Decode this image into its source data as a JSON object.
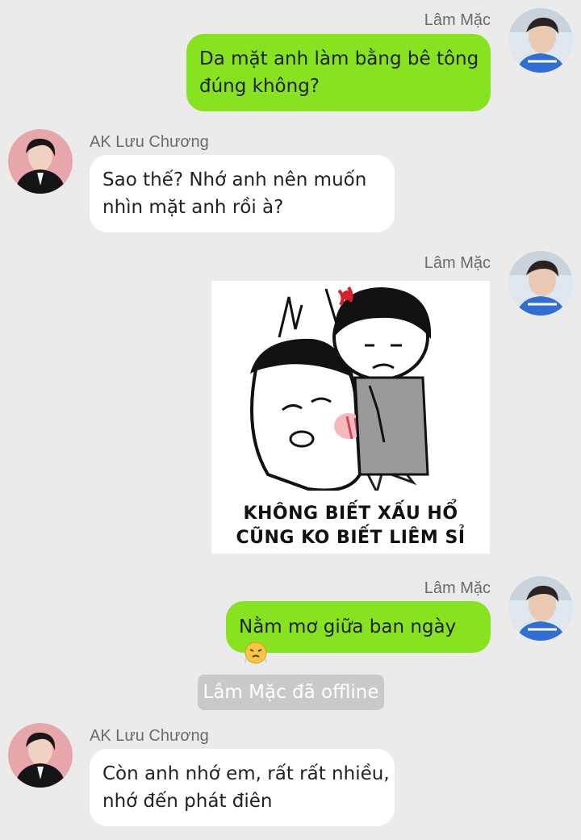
{
  "messages": [
    {
      "sender": "Lâm Mặc",
      "text_lines": [
        "Da mặt anh làm bằng bê tông",
        "đúng không?"
      ]
    },
    {
      "sender": "AK Lưu Chương",
      "text_lines": [
        "Sao thế? Nhớ anh nên muốn",
        "nhìn mặt anh rồi à?"
      ]
    },
    {
      "sender": "Lâm Mặc",
      "sticker_caption_lines": [
        "KHÔNG BIẾT XẤU HỔ",
        "CŨNG KO BIẾT LIÊM SỈ"
      ]
    },
    {
      "sender": "Lâm Mặc",
      "text": "Nằm mơ giữa ban ngày",
      "emoji": "huffing-face-emoji"
    },
    {
      "system": "Lâm Mặc đã offline"
    },
    {
      "sender": "AK Lưu Chương",
      "text_lines": [
        "Còn anh nhớ em, rất rất nhiều,",
        "nhớ đến phát điên"
      ]
    }
  ],
  "colors": {
    "background": "#ebebeb",
    "sent_bubble": "#87e21f",
    "received_bubble": "#ffffff",
    "system_badge": "#c9c9c9",
    "sender_name": "#6b6b6b"
  }
}
